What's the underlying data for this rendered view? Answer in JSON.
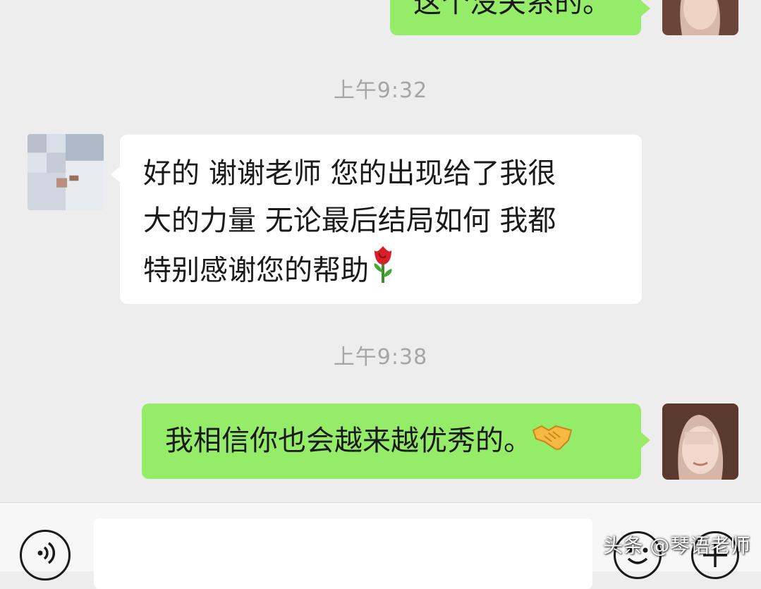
{
  "chat": {
    "messages": [
      {
        "side": "out",
        "text": "这个没关系的。",
        "partial": true
      },
      {
        "type": "time",
        "text": "上午9:32"
      },
      {
        "side": "in",
        "lines": [
          "好的 谢谢老师 您的出现给了我很",
          "大的力量 无论最后结局如何 我都",
          "特别感谢您的帮助"
        ],
        "emoji": "rose"
      },
      {
        "type": "time",
        "text": "上午9:38"
      },
      {
        "side": "out",
        "text": "我相信你也会越来越优秀的。",
        "emoji": "handshake"
      }
    ]
  },
  "input_bar": {
    "voice_icon": "voice-icon",
    "emoji_icon": "emoji-face-icon",
    "plus_icon": "plus-icon"
  },
  "watermark": "头条 @琴语老师",
  "colors": {
    "background": "#ededed",
    "outgoing_bubble": "#95ec69",
    "incoming_bubble": "#ffffff",
    "timestamp": "#a5a5a5"
  }
}
